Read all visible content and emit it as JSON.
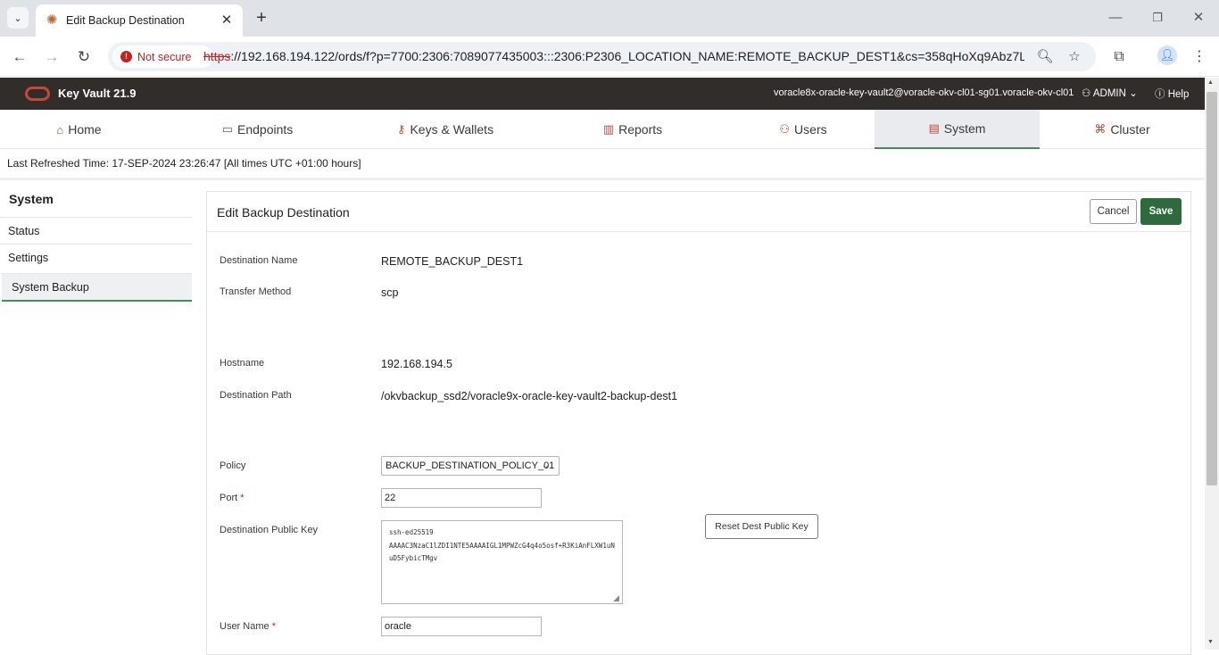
{
  "browser": {
    "tab_title": "Edit Backup Destination",
    "security_label": "Not secure",
    "url_scheme": "https",
    "url_rest": "://192.168.194.122/ords/f?p=7700:2306:7089077435003:::2306:P2306_LOCATION_NAME:REMOTE_BACKUP_DEST1&cs=358qHoXq9Abz7L6dYj8..."
  },
  "app": {
    "title": "Key Vault 21.9",
    "user_host": "voracle8x-oracle-key-vault2@voracle-okv-cl01-sg01.voracle-okv-cl01",
    "user": "ADMIN",
    "help": "Help"
  },
  "nav": {
    "tabs": [
      {
        "label": "Home",
        "icon": "home-icon"
      },
      {
        "label": "Endpoints",
        "icon": "monitor-icon"
      },
      {
        "label": "Keys & Wallets",
        "icon": "key-icon"
      },
      {
        "label": "Reports",
        "icon": "bar-chart-icon"
      },
      {
        "label": "Users",
        "icon": "users-icon"
      },
      {
        "label": "System",
        "icon": "list-icon",
        "active": true
      },
      {
        "label": "Cluster",
        "icon": "cluster-icon"
      }
    ]
  },
  "refresh_text": "Last Refreshed Time: 17-SEP-2024 23:26:47 [All times UTC +01:00 hours]",
  "sidebar": {
    "title": "System",
    "items": [
      {
        "label": "Status"
      },
      {
        "label": "Settings"
      },
      {
        "label": "System Backup",
        "active": true
      }
    ]
  },
  "panel": {
    "title": "Edit Backup Destination",
    "cancel_label": "Cancel",
    "save_label": "Save",
    "fields": {
      "destination_name_label": "Destination Name",
      "destination_name_value": "REMOTE_BACKUP_DEST1",
      "transfer_method_label": "Transfer Method",
      "transfer_method_value": "scp",
      "hostname_label": "Hostname",
      "hostname_value": "192.168.194.5",
      "destination_path_label": "Destination Path",
      "destination_path_value": "/okvbackup_ssd2/voracle9x-oracle-key-vault2-backup-dest1",
      "policy_label": "Policy",
      "policy_value": "BACKUP_DESTINATION_POLICY_01",
      "port_label": "Port",
      "port_value": "22",
      "public_key_label": "Destination Public Key",
      "public_key_value": "ssh-ed25519\nAAAAC3NzaC1lZDI1NTE5AAAAIGL1MPWZcG4q4o5osf+R3KiAnFLXW1uNuD5FybicTMgv",
      "reset_key_label": "Reset Dest Public Key",
      "user_name_label": "User Name",
      "user_name_value": "oracle",
      "required_mark": "*"
    }
  }
}
